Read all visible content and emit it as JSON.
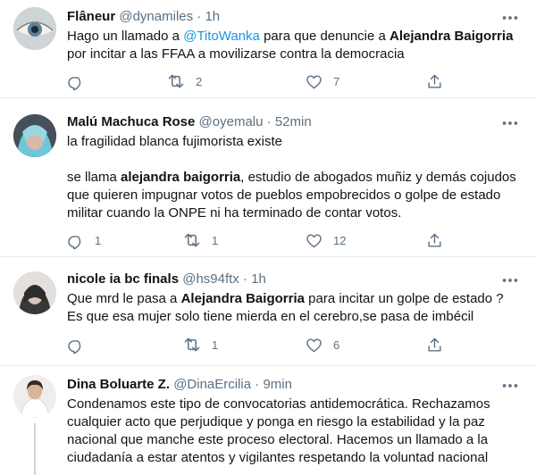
{
  "tweets": [
    {
      "name": "Flâneur",
      "handle": "@dynamiles",
      "time": "1h",
      "text": {
        "p1": "Hago un llamado a ",
        "mention": "@TitoWanka",
        "p2": " para que denuncie a ",
        "bold": "Alejandra Baigorria",
        "p3": "por incitar a las FFAA a movilizarse contra la democracia"
      },
      "replies": "",
      "retweets": "2",
      "likes": "7"
    },
    {
      "name": "Malú Machuca Rose",
      "handle": "@oyemalu",
      "time": "52min",
      "text": {
        "line1": "la fragilidad blanca fujimorista existe",
        "p2": "se llama ",
        "bold": "alejandra baigorria",
        "p3": ", estudio de abogados muñiz y demás cojudos",
        "line3": "que quieren impugnar votos de pueblos empobrecidos o golpe de estado",
        "line4": "militar cuando la ONPE ni ha terminado de contar votos."
      },
      "replies": "1",
      "retweets": "1",
      "likes": "12"
    },
    {
      "name": "nicole ia bc finals",
      "handle": "@hs94ftx",
      "time": "1h",
      "text": {
        "p1": "Que mrd le pasa a ",
        "bold": "Alejandra Baigorria",
        "p2": " para incitar un golpe de estado ?",
        "line2": "Es que esa mujer solo tiene mierda en el cerebro,se pasa de imbécil"
      },
      "replies": "",
      "retweets": "1",
      "likes": "6"
    },
    {
      "name": "Dina Boluarte Z.",
      "handle": "@DinaErcilia",
      "time": "9min",
      "text": {
        "line1": "Condenamos este tipo de convocatorias antidemocrática. Rechazamos",
        "line2": "cualquier acto que perjudique y ponga en riesgo la estabilidad y la paz",
        "line3": "nacional que manche este proceso electoral. Hacemos un llamado a la",
        "line4": "ciudadanía a estar atentos y vigilantes respetando la voluntad nacional"
      }
    }
  ],
  "sep": " · ",
  "colors": {
    "link": "#1b95e0",
    "muted": "#5b7083",
    "border": "#e6ecf0"
  },
  "icons": [
    "reply-icon",
    "retweet-icon",
    "like-icon",
    "share-icon",
    "more-icon"
  ]
}
